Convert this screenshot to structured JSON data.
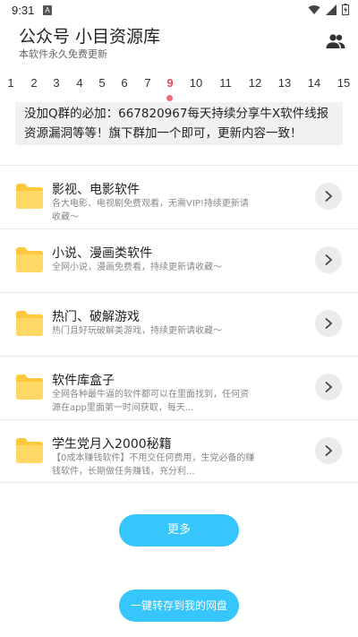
{
  "status_bar": {
    "time": "9:31",
    "notification_badge": "A",
    "icons": [
      "wifi-icon",
      "signal-icon",
      "battery-icon"
    ]
  },
  "header": {
    "title": "公众号 小目资源库",
    "subtitle": "本软件永久免费更新",
    "action_icon": "group-icon"
  },
  "tabs": {
    "items": [
      "1",
      "2",
      "3",
      "4",
      "5",
      "6",
      "7",
      "8",
      "9",
      "10",
      "11",
      "12",
      "13",
      "14",
      "15"
    ],
    "active": "9",
    "active_color": "#e64a5e"
  },
  "notice": {
    "line1": "没加Q群的必加：667820967每天持续分享牛X软件线报",
    "line2": "资源漏洞等等！旗下群加一个即可，更新内容一致！"
  },
  "list": [
    {
      "title": "影视、电影软件",
      "desc": "各大电影、电视剧免费观看，无需VIP!持续更新请收藏～",
      "icon": "folder-icon"
    },
    {
      "title": "小说、漫画类软件",
      "desc": "全网小说，漫画免费看，持续更新请收藏～",
      "icon": "folder-icon"
    },
    {
      "title": "热门、破解游戏",
      "desc": "热门且好玩破解类游戏，持续更新请收藏～",
      "icon": "folder-icon"
    },
    {
      "title": "软件库盒子",
      "desc": "全网各种最牛逼的软件都可以在里面找到，任何资源在app里面第一时间获取，每天...",
      "icon": "folder-icon"
    },
    {
      "title": "学生党月入2000秘籍",
      "desc": "【0成本赚钱软件】不用交任何费用，生党必备的赚钱软件，长期做任务赚钱，充分利...",
      "icon": "folder-icon"
    }
  ],
  "buttons": {
    "more": "更多",
    "save": "一键转存到我的网盘"
  },
  "colors": {
    "accent": "#36c6fb",
    "folder": "#ffc83d",
    "tab_active": "#e64a5e"
  }
}
